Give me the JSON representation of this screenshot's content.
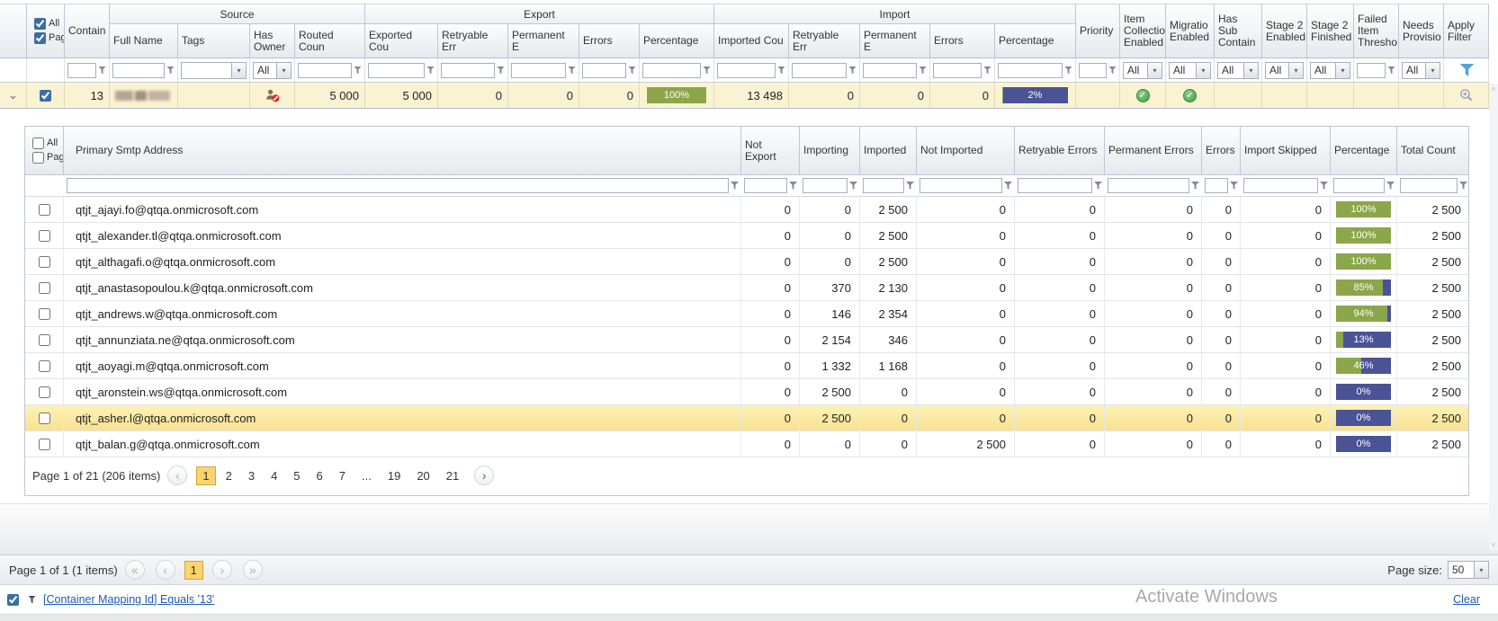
{
  "colors": {
    "progress_green": "#8ca64a",
    "progress_blue": "#4a5396",
    "selected_row_yellow": "#faf3d3",
    "highlight_row_yellow": "#f8e292",
    "active_page_yellow": "#fcd46e",
    "link_blue": "#1f5bb5",
    "check_green": "#3f9e3f"
  },
  "icons": {
    "expand": "⌄",
    "check": "✓",
    "dd_arrow": "▾",
    "first": "«",
    "prev": "‹",
    "next": "›",
    "last": "»",
    "scroll_up": "˄",
    "scroll_down": "˅",
    "ellipsis_note": "magnifier-and-funnel-drawn-in-css"
  },
  "topgrid": {
    "select": {
      "all": "All",
      "page": "Pag",
      "all_checked": true,
      "page_checked": true
    },
    "bands": {
      "source": "Source",
      "export": "Export",
      "import": "Import"
    },
    "columns": {
      "contain": "Contain",
      "full_name": "Full Name",
      "tags": "Tags",
      "has_owner": "Has Owner",
      "routed": "Routed Coun",
      "exported": "Exported Cou",
      "exp_retryable": "Retryable Err",
      "exp_permanent": "Permanent E",
      "exp_errors": "Errors",
      "exp_percentage": "Percentage",
      "imported": "Imported Cou",
      "imp_retryable": "Retryable Err",
      "imp_permanent": "Permanent E",
      "imp_errors": "Errors",
      "imp_percentage": "Percentage",
      "priority": "Priority",
      "item_collection": "Item Collectio Enabled",
      "migration": "Migratio Enabled",
      "has_sub": "Has Sub Contain",
      "stage2_enabled": "Stage 2 Enabled",
      "stage2_finished": "Stage 2 Finished",
      "failed_item": "Failed Item Thresho",
      "needs_provision": "Needs Provisio",
      "apply_filter": "Apply Filter"
    },
    "filter_dropdown_value": "All",
    "row": {
      "checked": true,
      "contain": "13",
      "routed": "5 000",
      "exported": "5 000",
      "exp_retryable": "0",
      "exp_permanent": "0",
      "exp_errors": "0",
      "exp_pct": 100,
      "exp_pct_label": "100%",
      "imported": "13 498",
      "imp_retryable": "0",
      "imp_permanent": "0",
      "imp_errors": "0",
      "imp_pct": 2,
      "imp_pct_label": "2%",
      "item_collection_enabled": true,
      "migration_enabled": true
    }
  },
  "detail": {
    "select": {
      "all": "All",
      "page": "Pag",
      "all_checked": false,
      "page_checked": false
    },
    "columns": {
      "smtp": "Primary Smtp Address",
      "not_exported": "Not Export",
      "importing": "Importing",
      "imported": "Imported",
      "not_imported": "Not Imported",
      "retryable": "Retryable Errors",
      "permanent": "Permanent Errors",
      "errors": "Errors",
      "skipped": "Import Skipped",
      "percentage": "Percentage",
      "total": "Total Count"
    },
    "rows": [
      {
        "email": "qtjt_ajayi.fo@qtqa.onmicrosoft.com",
        "not_exported": "0",
        "importing": "0",
        "imported": "2 500",
        "not_imported": "0",
        "retryable": "0",
        "permanent": "0",
        "errors": "0",
        "skipped": "0",
        "pct": 100,
        "pct_label": "100%",
        "total": "2 500",
        "highlighted": false
      },
      {
        "email": "qtjt_alexander.tl@qtqa.onmicrosoft.com",
        "not_exported": "0",
        "importing": "0",
        "imported": "2 500",
        "not_imported": "0",
        "retryable": "0",
        "permanent": "0",
        "errors": "0",
        "skipped": "0",
        "pct": 100,
        "pct_label": "100%",
        "total": "2 500",
        "highlighted": false
      },
      {
        "email": "qtjt_althagafi.o@qtqa.onmicrosoft.com",
        "not_exported": "0",
        "importing": "0",
        "imported": "2 500",
        "not_imported": "0",
        "retryable": "0",
        "permanent": "0",
        "errors": "0",
        "skipped": "0",
        "pct": 100,
        "pct_label": "100%",
        "total": "2 500",
        "highlighted": false
      },
      {
        "email": "qtjt_anastasopoulou.k@qtqa.onmicrosoft.com",
        "not_exported": "0",
        "importing": "370",
        "imported": "2 130",
        "not_imported": "0",
        "retryable": "0",
        "permanent": "0",
        "errors": "0",
        "skipped": "0",
        "pct": 85,
        "pct_label": "85%",
        "total": "2 500",
        "highlighted": false
      },
      {
        "email": "qtjt_andrews.w@qtqa.onmicrosoft.com",
        "not_exported": "0",
        "importing": "146",
        "imported": "2 354",
        "not_imported": "0",
        "retryable": "0",
        "permanent": "0",
        "errors": "0",
        "skipped": "0",
        "pct": 94,
        "pct_label": "94%",
        "total": "2 500",
        "highlighted": false
      },
      {
        "email": "qtjt_annunziata.ne@qtqa.onmicrosoft.com",
        "not_exported": "0",
        "importing": "2 154",
        "imported": "346",
        "not_imported": "0",
        "retryable": "0",
        "permanent": "0",
        "errors": "0",
        "skipped": "0",
        "pct": 13,
        "pct_label": "13%",
        "total": "2 500",
        "highlighted": false
      },
      {
        "email": "qtjt_aoyagi.m@qtqa.onmicrosoft.com",
        "not_exported": "0",
        "importing": "1 332",
        "imported": "1 168",
        "not_imported": "0",
        "retryable": "0",
        "permanent": "0",
        "errors": "0",
        "skipped": "0",
        "pct": 46,
        "pct_label": "46%",
        "total": "2 500",
        "highlighted": false
      },
      {
        "email": "qtjt_aronstein.ws@qtqa.onmicrosoft.com",
        "not_exported": "0",
        "importing": "2 500",
        "imported": "0",
        "not_imported": "0",
        "retryable": "0",
        "permanent": "0",
        "errors": "0",
        "skipped": "0",
        "pct": 0,
        "pct_label": "0%",
        "total": "2 500",
        "highlighted": false
      },
      {
        "email": "qtjt_asher.l@qtqa.onmicrosoft.com",
        "not_exported": "0",
        "importing": "2 500",
        "imported": "0",
        "not_imported": "0",
        "retryable": "0",
        "permanent": "0",
        "errors": "0",
        "skipped": "0",
        "pct": 0,
        "pct_label": "0%",
        "total": "2 500",
        "highlighted": true
      },
      {
        "email": "qtjt_balan.g@qtqa.onmicrosoft.com",
        "not_exported": "0",
        "importing": "0",
        "imported": "0",
        "not_imported": "2 500",
        "retryable": "0",
        "permanent": "0",
        "errors": "0",
        "skipped": "0",
        "pct": 0,
        "pct_label": "0%",
        "total": "2 500",
        "highlighted": false
      }
    ],
    "pagination": {
      "summary": "Page 1 of 21 (206 items)",
      "pages": [
        {
          "label": "1",
          "current": true
        },
        {
          "label": "2",
          "current": false
        },
        {
          "label": "3",
          "current": false
        },
        {
          "label": "4",
          "current": false
        },
        {
          "label": "5",
          "current": false
        },
        {
          "label": "6",
          "current": false
        },
        {
          "label": "7",
          "current": false
        },
        {
          "label": "...",
          "current": false
        },
        {
          "label": "19",
          "current": false
        },
        {
          "label": "20",
          "current": false
        },
        {
          "label": "21",
          "current": false
        }
      ]
    }
  },
  "footer": {
    "pager_summary": "Page 1 of 1 (1 items)",
    "page": "1",
    "page_size_label": "Page size:",
    "page_size": "50"
  },
  "filterbar": {
    "checked": true,
    "expression": "[Container Mapping Id] Equals '13'",
    "clear": "Clear"
  },
  "watermark": "Activate Windows"
}
